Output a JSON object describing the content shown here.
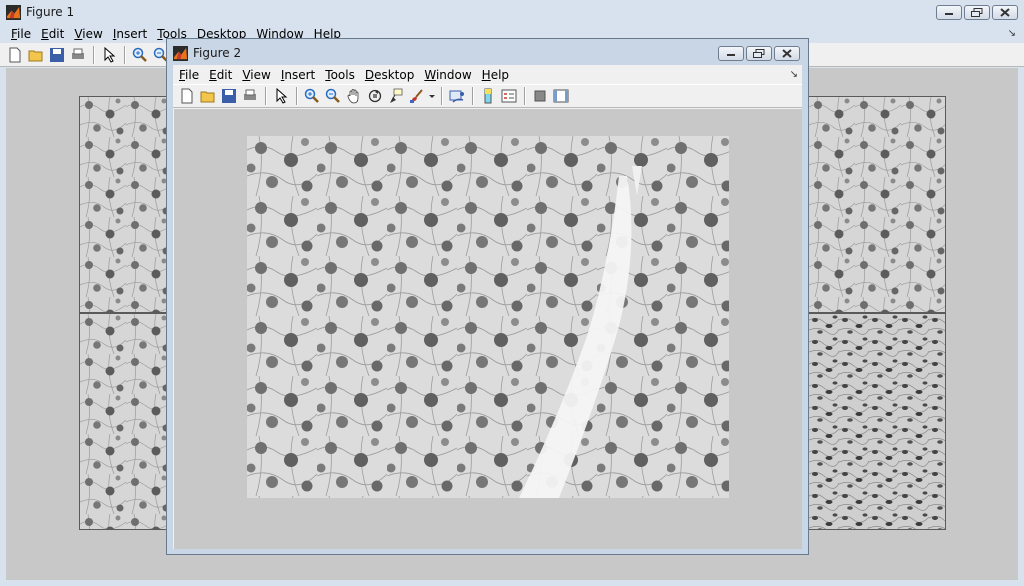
{
  "figure1": {
    "title": "Figure 1",
    "menu": [
      {
        "pre": "",
        "u": "F",
        "post": "ile"
      },
      {
        "pre": "",
        "u": "E",
        "post": "dit"
      },
      {
        "pre": "",
        "u": "V",
        "post": "iew"
      },
      {
        "pre": "",
        "u": "I",
        "post": "nsert"
      },
      {
        "pre": "",
        "u": "T",
        "post": "ools"
      },
      {
        "pre": "",
        "u": "D",
        "post": "esktop"
      },
      {
        "pre": "",
        "u": "W",
        "post": "indow"
      },
      {
        "pre": "",
        "u": "H",
        "post": "elp"
      }
    ],
    "dock_glyph": "↘"
  },
  "figure2": {
    "title": "Figure 2",
    "menu": [
      {
        "pre": "",
        "u": "F",
        "post": "ile"
      },
      {
        "pre": "",
        "u": "E",
        "post": "dit"
      },
      {
        "pre": "",
        "u": "V",
        "post": "iew"
      },
      {
        "pre": "",
        "u": "I",
        "post": "nsert"
      },
      {
        "pre": "",
        "u": "T",
        "post": "ools"
      },
      {
        "pre": "",
        "u": "D",
        "post": "esktop"
      },
      {
        "pre": "",
        "u": "W",
        "post": "indow"
      },
      {
        "pre": "",
        "u": "H",
        "post": "elp"
      }
    ],
    "dock_glyph": "↘"
  },
  "colors": {
    "chrome": "#c9d6e6",
    "canvas": "#c8c8c8",
    "toolbar": "#f0f0f0"
  }
}
